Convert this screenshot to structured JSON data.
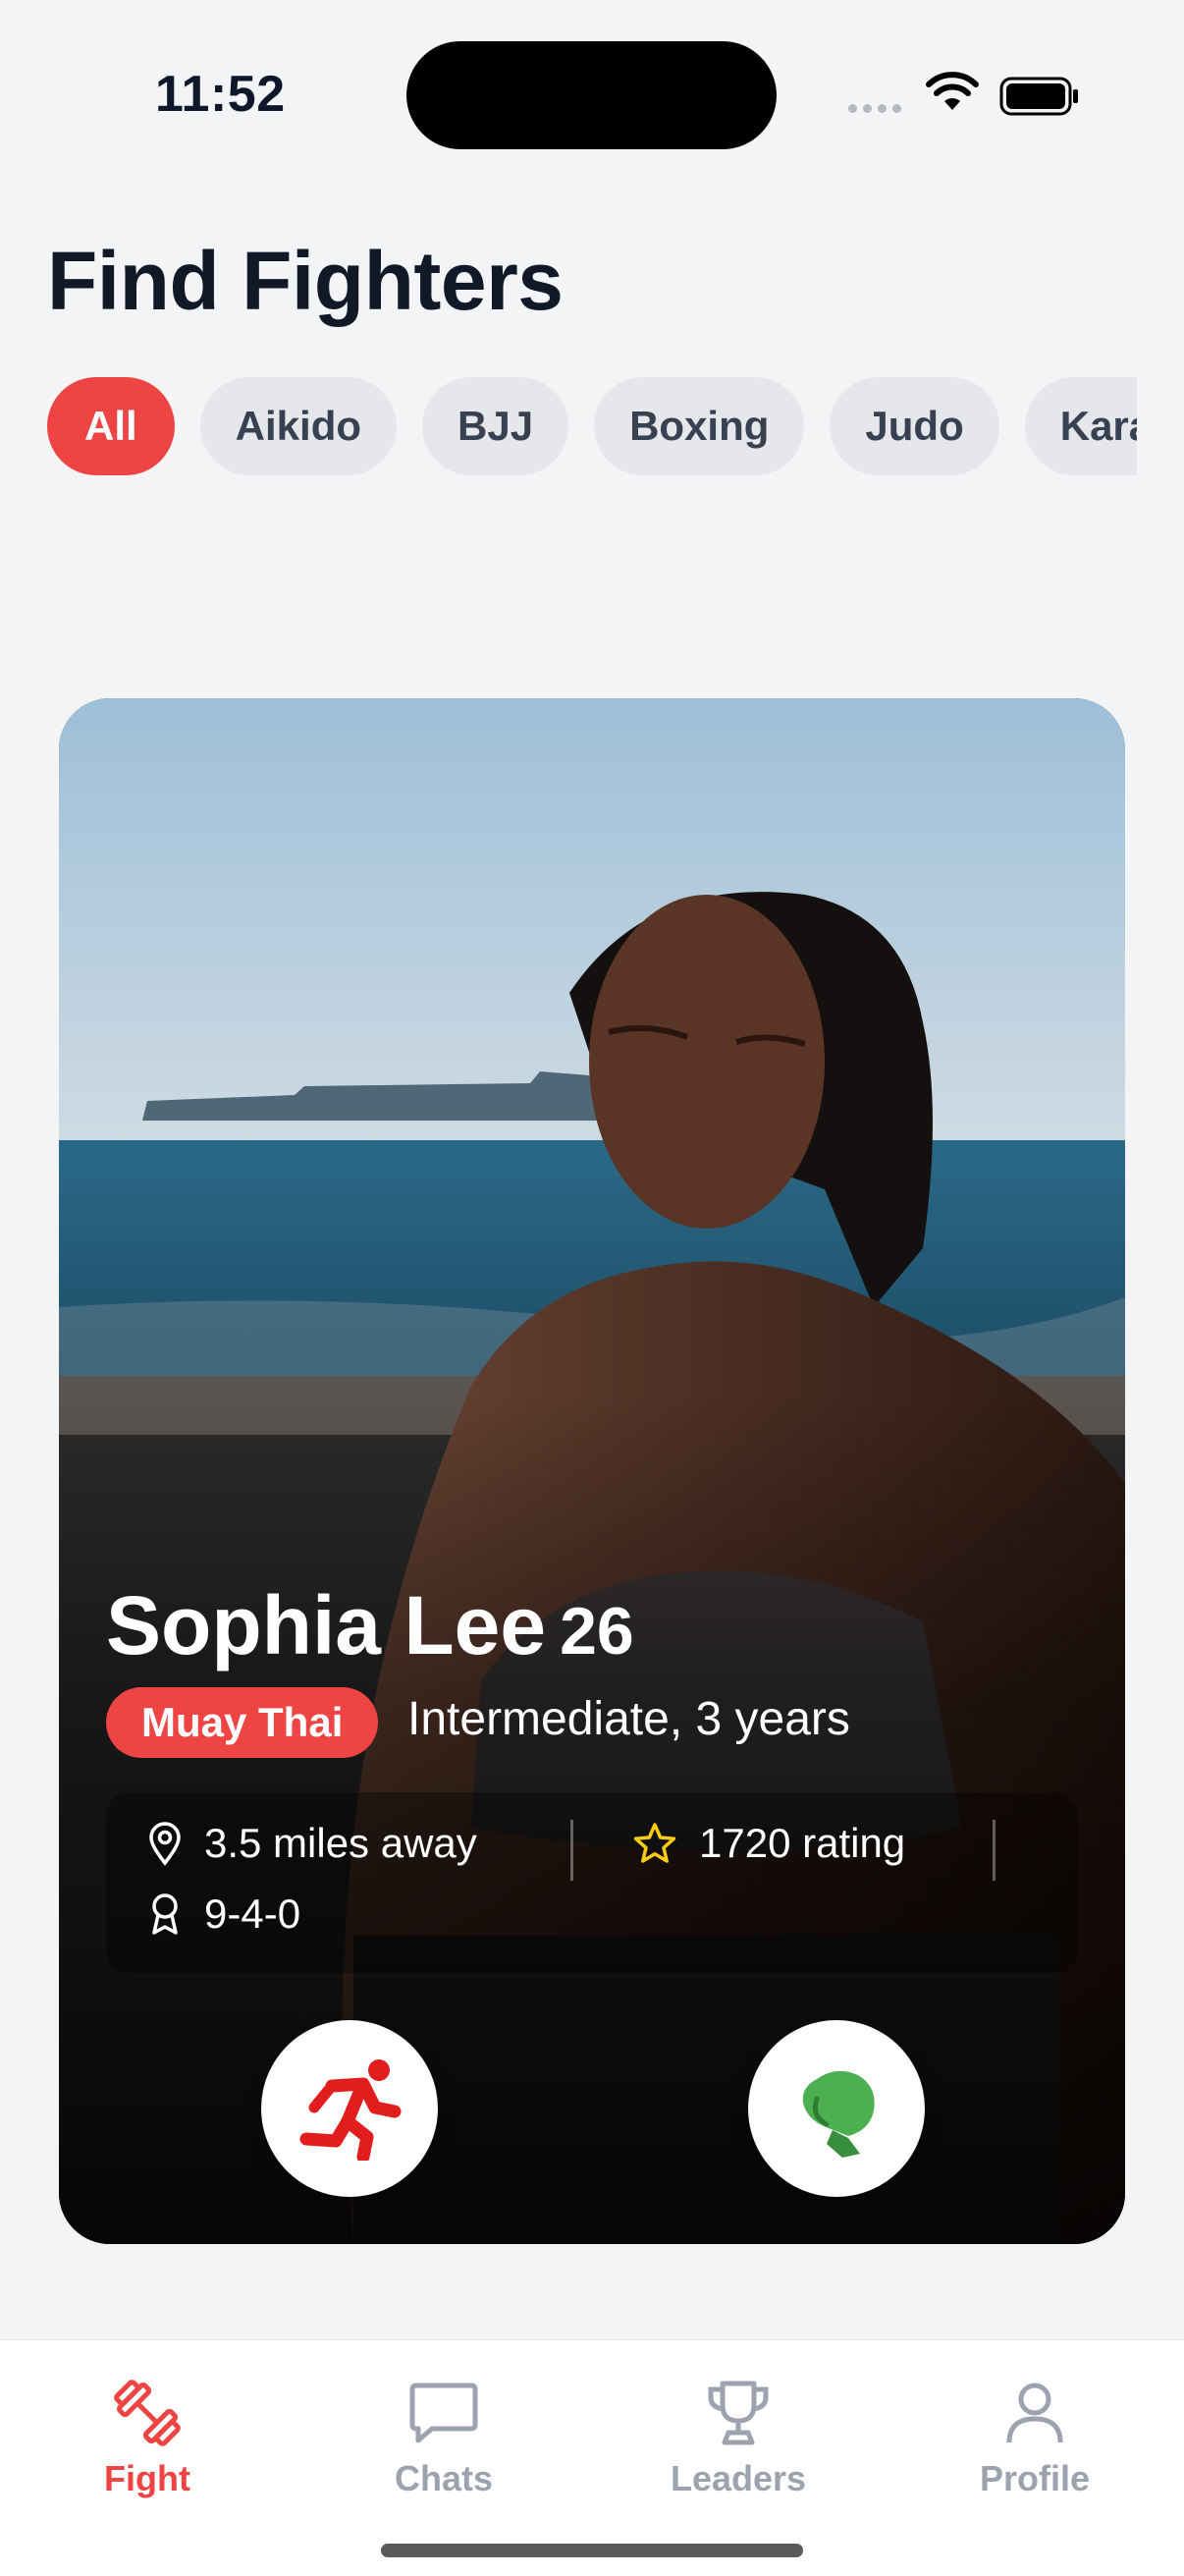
{
  "status_bar": {
    "time": "11:52"
  },
  "page": {
    "title": "Find Fighters"
  },
  "filters": [
    "All",
    "Aikido",
    "BJJ",
    "Boxing",
    "Judo",
    "Karate"
  ],
  "active_filter": "All",
  "card": {
    "name": "Sophia Lee",
    "age": "26",
    "discipline": "Muay Thai",
    "experience": "Intermediate, 3 years",
    "distance": "3.5 miles away",
    "rating": "1720 rating",
    "record": "9-4-0",
    "actions": {
      "run": "run-icon",
      "fight": "boxing-glove-icon"
    }
  },
  "tabs": [
    {
      "label": "Fight",
      "icon": "dumbbell-icon",
      "active": true
    },
    {
      "label": "Chats",
      "icon": "chat-icon",
      "active": false
    },
    {
      "label": "Leaders",
      "icon": "trophy-icon",
      "active": false
    },
    {
      "label": "Profile",
      "icon": "user-icon",
      "active": false
    }
  ],
  "colors": {
    "accent": "#ef4444",
    "background": "#f3f4f6",
    "star": "#facc15",
    "glove": "#4caf50"
  }
}
